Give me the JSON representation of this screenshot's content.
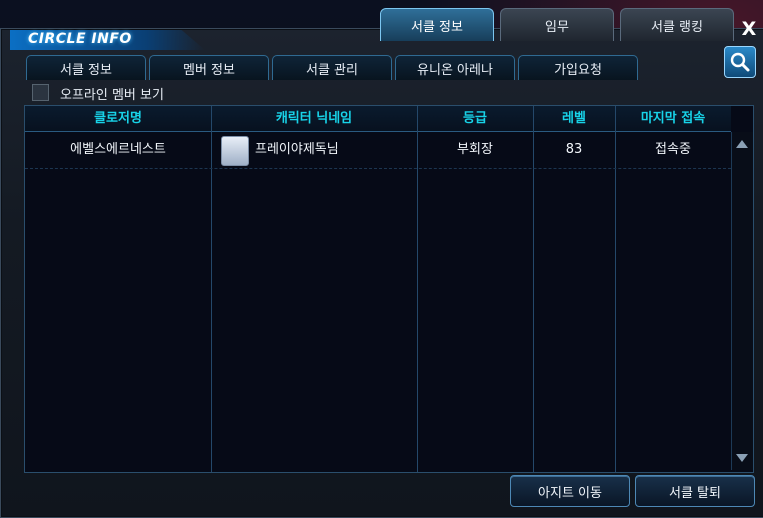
{
  "window": {
    "brand": "CIRCLE INFO",
    "close_label": "X"
  },
  "top_tabs": [
    {
      "label": "서클 정보",
      "active": true
    },
    {
      "label": "임무",
      "active": false
    },
    {
      "label": "서클 랭킹",
      "active": false
    }
  ],
  "sub_tabs": [
    {
      "label": "서클 정보"
    },
    {
      "label": "멤버 정보"
    },
    {
      "label": "서클 관리"
    },
    {
      "label": "유니온 아레나"
    },
    {
      "label": "가입요청"
    }
  ],
  "filter": {
    "offline_label": "오프라인 멤버 보기",
    "checked": false
  },
  "table": {
    "columns": [
      "클로저명",
      "캐릭터 닉네임",
      "등급",
      "레벨",
      "마지막 접속"
    ],
    "rows": [
      {
        "closer": "에벨스에르네스트",
        "nickname": "프레이야제독님",
        "rank": "부회장",
        "level": "83",
        "last_login": "접속중"
      }
    ]
  },
  "buttons": {
    "agit_move": "아지트 이동",
    "leave_circle": "서클 탈퇴"
  },
  "icons": {
    "search": "search-icon",
    "scroll_up": "arrow-up-icon",
    "scroll_down": "arrow-down-icon"
  },
  "colors": {
    "header_text": "#18d3e8",
    "active_tab": "#2f6f99",
    "accent": "#0b6fc4"
  }
}
